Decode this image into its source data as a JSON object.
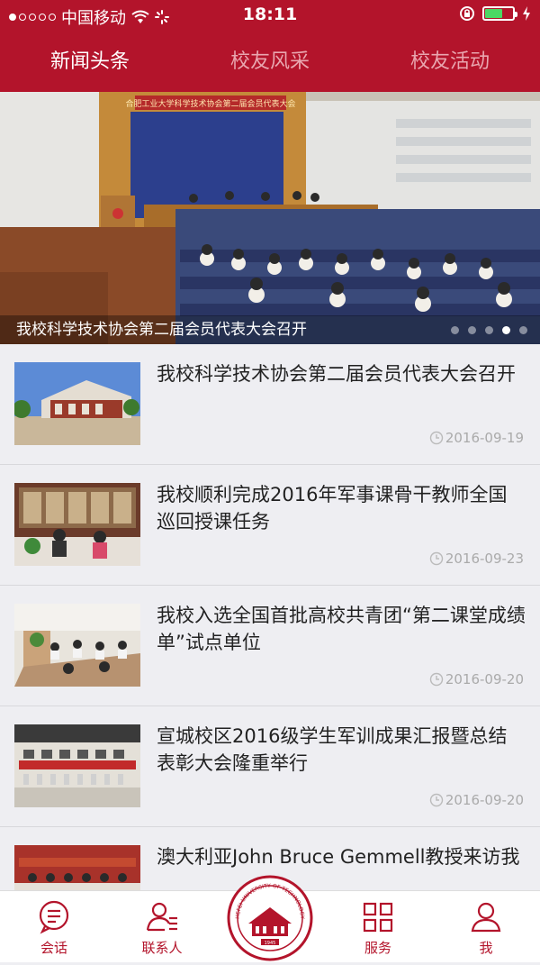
{
  "status": {
    "carrier": "中国移动",
    "time": "18:11"
  },
  "tabs": [
    {
      "label": "新闻头条",
      "active": true
    },
    {
      "label": "校友风采",
      "active": false
    },
    {
      "label": "校友活动",
      "active": false
    }
  ],
  "banner": {
    "caption": "我校科学技术协会第二届会员代表大会召开",
    "banner_text": "合肥工业大学科学技术协会第二届会员代表大会",
    "slide_count": 5,
    "current_slide": 4
  },
  "news": [
    {
      "title": "我校科学技术协会第二届会员代表大会召开",
      "date": "2016-09-19"
    },
    {
      "title": "我校顺利完成2016年军事课骨干教师全国巡回授课任务",
      "date": "2016-09-23"
    },
    {
      "title": "我校入选全国首批高校共青团“第二课堂成绩单”试点单位",
      "date": "2016-09-20"
    },
    {
      "title": "宣城校区2016级学生军训成果汇报暨总结表彰大会隆重举行",
      "date": "2016-09-20"
    },
    {
      "title": "澳大利亚John Bruce Gemmell教授来访我",
      "date": ""
    }
  ],
  "bottom_nav": {
    "chat": "会话",
    "contacts": "联系人",
    "services": "服务",
    "me": "我",
    "seal_text": "HEFEI UNIVERSITY OF TECHNOLOGY",
    "seal_year": "1945"
  },
  "colors": {
    "brand": "#b3142b",
    "accent": "#b3142b",
    "text": "#222222",
    "date": "#aaaaaa"
  }
}
